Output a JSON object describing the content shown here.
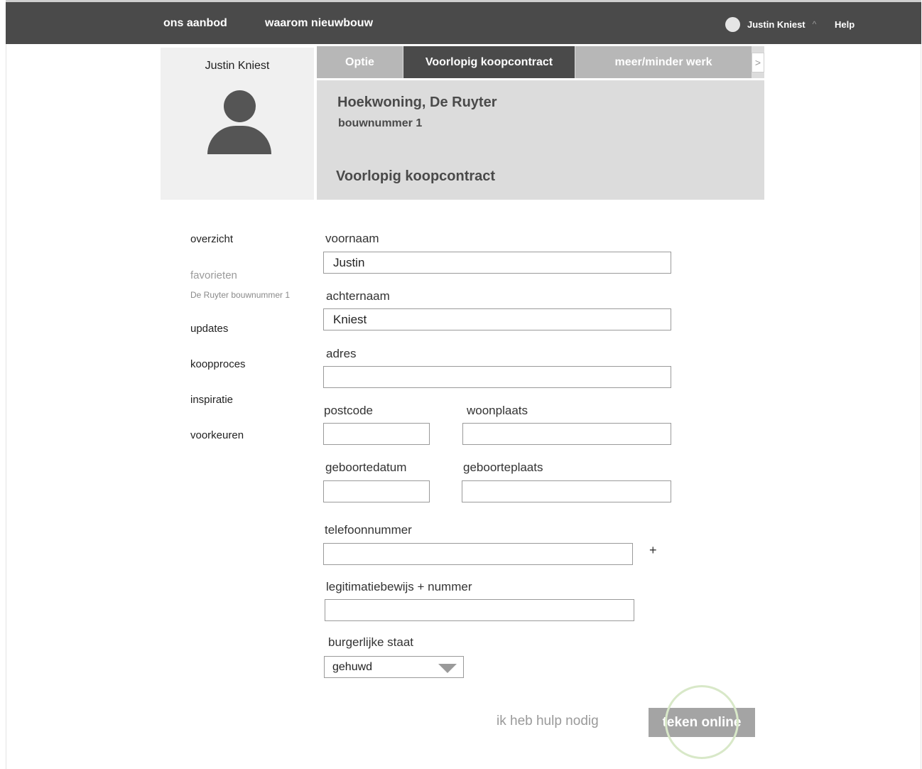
{
  "topbar": {
    "nav": [
      "ons aanbod",
      "waarom nieuwbouw"
    ],
    "user_name": "Justin Kniest",
    "user_chevron": "^",
    "help": "Help"
  },
  "profile": {
    "name": "Justin Kniest",
    "avatar_icon": "user-avatar-icon"
  },
  "tabs": {
    "items": [
      "Optie",
      "Voorlopig koopcontract",
      "meer/minder werk"
    ],
    "active": "Voorlopig koopcontract",
    "next_arrow": ">"
  },
  "banner": {
    "title": "Hoekwoning, De Ruyter",
    "subtitle": "bouwnummer 1",
    "section": "Voorlopig koopcontract"
  },
  "sidebar": {
    "overview": "overzicht",
    "favorites": "favorieten",
    "favorite_item": "De Ruyter bouwnummer 1",
    "updates": "updates",
    "purchase_process": "koopproces",
    "inspiration": "inspiratie",
    "preferences": "voorkeuren"
  },
  "form": {
    "first_name": {
      "label": "voornaam",
      "value": "Justin"
    },
    "last_name": {
      "label": "achternaam",
      "value": "Kniest"
    },
    "address": {
      "label": "adres",
      "value": ""
    },
    "postcode": {
      "label": "postcode",
      "value": ""
    },
    "city": {
      "label": "woonplaats",
      "value": ""
    },
    "birth_date": {
      "label": "geboortedatum",
      "value": ""
    },
    "birth_place": {
      "label": "geboorteplaats",
      "value": ""
    },
    "phone": {
      "label": "telefoonnummer",
      "value": "",
      "add": "+"
    },
    "id_doc": {
      "label": "legitimatiebewijs + nummer",
      "value": ""
    },
    "marital": {
      "label": "burgerlijke staat",
      "value": "gehuwd"
    }
  },
  "actions": {
    "help": "ik heb hulp nodig",
    "sign": "teken online"
  },
  "colors": {
    "header": "#4a4a4a",
    "panel": "#dcdcdc",
    "button": "#a4a4a4",
    "highlight_ring": "#d8e8c8"
  }
}
